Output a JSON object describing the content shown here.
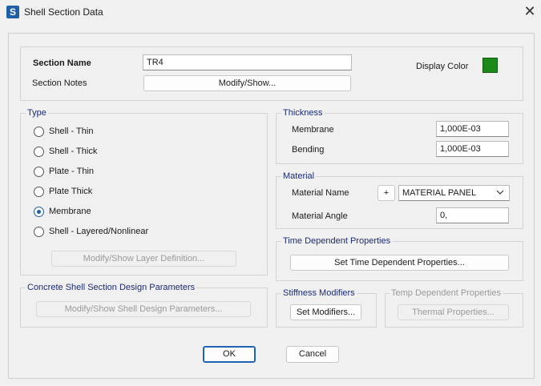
{
  "window": {
    "title": "Shell Section Data",
    "app_icon_letter": "S",
    "close_glyph": "✕"
  },
  "section": {
    "name_label": "Section Name",
    "name_value": "TR4",
    "notes_label": "Section Notes",
    "notes_button": "Modify/Show...",
    "display_color_label": "Display Color",
    "display_color": "#1b8a1b"
  },
  "type": {
    "legend": "Type",
    "options": [
      {
        "label": "Shell - Thin",
        "selected": false
      },
      {
        "label": "Shell - Thick",
        "selected": false
      },
      {
        "label": "Plate - Thin",
        "selected": false
      },
      {
        "label": "Plate Thick",
        "selected": false
      },
      {
        "label": "Membrane",
        "selected": true
      },
      {
        "label": "Shell - Layered/Nonlinear",
        "selected": false
      }
    ],
    "layer_button": "Modify/Show Layer Definition..."
  },
  "concrete": {
    "legend": "Concrete Shell Section Design Parameters",
    "button": "Modify/Show Shell Design Parameters..."
  },
  "thickness": {
    "legend": "Thickness",
    "membrane_label": "Membrane",
    "membrane_value": "1,000E-03",
    "bending_label": "Bending",
    "bending_value": "1,000E-03"
  },
  "material": {
    "legend": "Material",
    "name_label": "Material Name",
    "plus_button": "+",
    "name_value": "MATERIAL PANEL",
    "angle_label": "Material Angle",
    "angle_value": "0,"
  },
  "time_dependent": {
    "legend": "Time Dependent Properties",
    "button": "Set Time Dependent Properties..."
  },
  "stiffness": {
    "legend": "Stiffness Modifiers",
    "button": "Set Modifiers..."
  },
  "temp_dependent": {
    "legend": "Temp Dependent Properties",
    "button": "Thermal Properties..."
  },
  "footer": {
    "ok": "OK",
    "cancel": "Cancel"
  }
}
